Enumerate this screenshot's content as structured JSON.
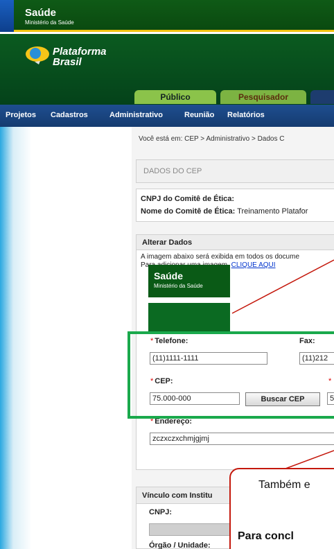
{
  "header": {
    "saude": "Saúde",
    "ministerio": "Ministério da Saúde",
    "brand_line1": "Plataforma",
    "brand_line2": "Brasil"
  },
  "tabs": [
    {
      "label": "Público"
    },
    {
      "label": "Pesquisador"
    }
  ],
  "nav": [
    "Projetos",
    "Cadastros",
    "Administrativo",
    "Reunião",
    "Relatórios"
  ],
  "breadcrumb": "Você está em: CEP > Administrativo > Dados C",
  "dados_cep_title": "DADOS DO CEP",
  "cnpj_label": "CNPJ do Comitê de Ética:",
  "nome_label": "Nome do Comitê de Ética:",
  "nome_value": "Treinamento Platafor",
  "alterar": {
    "title": "Alterar Dados",
    "info1": "A imagem abaixo será exibida em todos os docume",
    "info2_prefix": "Para adicionar uma imagem,",
    "info2_link": "CLIQUE AQUI",
    "preview_saude": "Saúde",
    "preview_ministerio": "Ministério da Saúde"
  },
  "form": {
    "telefone_label": "Telefone:",
    "telefone_value": "(11)1111-1111",
    "fax_label": "Fax:",
    "fax_value": "(11)212",
    "cep_label": "CEP:",
    "cep_value": "75.000-000",
    "buscar_cep_label": "Buscar CEP",
    "extra_value": "5",
    "endereco_label": "Endereço:",
    "endereco_value": "zczxczxchmjgjmj",
    "required_mark": "*"
  },
  "vinculo": {
    "title": "Vínculo com Institu",
    "cnpj_label": "CNPJ:",
    "orgao_label": "Órgão / Unidade:"
  },
  "callout": {
    "line1": "Também e",
    "line2": "Para concl"
  },
  "colors": {
    "highlight": "#1aa94c",
    "callout_border": "#c4180c",
    "nav_bg": "#1e4e8f",
    "brand_green": "#0b5b20"
  }
}
